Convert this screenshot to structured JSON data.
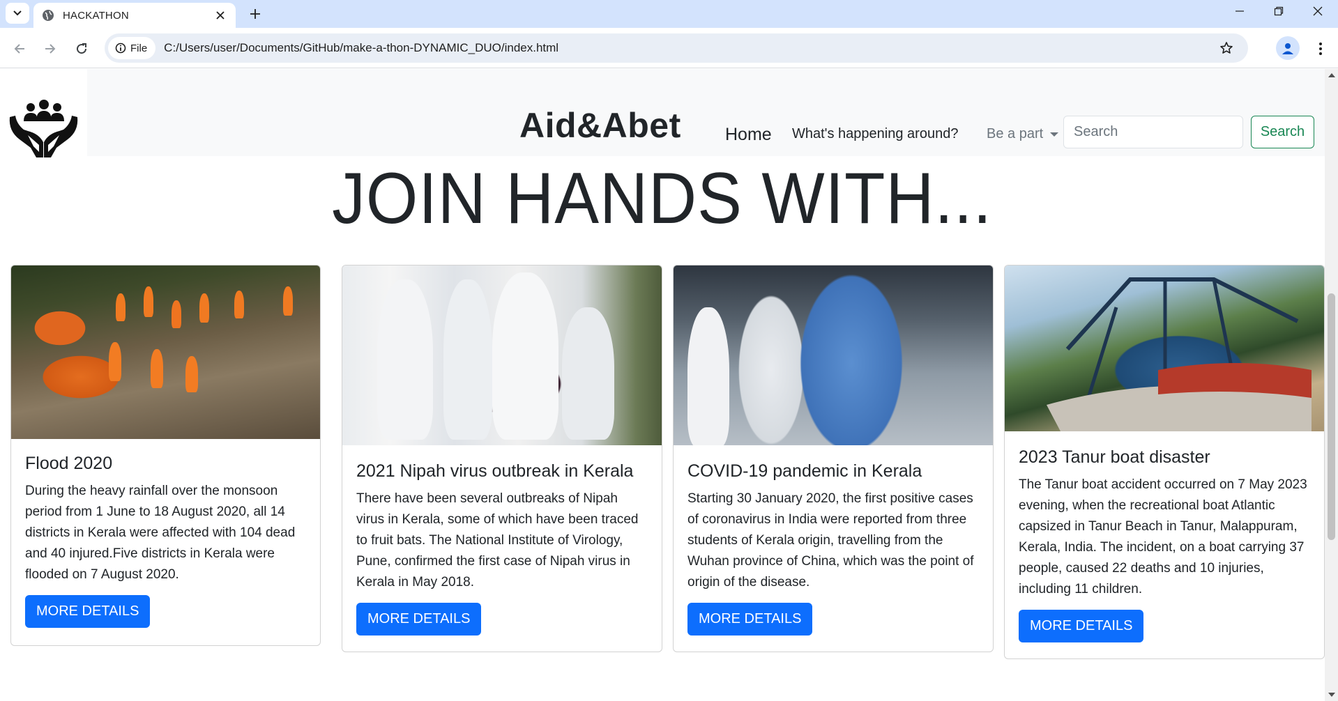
{
  "browser": {
    "tab_title": "HACKATHON",
    "file_chip": "File",
    "url": "C:/Users/user/Documents/GitHub/make-a-thon-DYNAMIC_DUO/index.html"
  },
  "navbar": {
    "brand": "Aid&Abet",
    "links": {
      "home": "Home",
      "happening": "What's happening around?",
      "bepart": "Be a part"
    },
    "search_placeholder": "Search",
    "search_button": "Search"
  },
  "hero": {
    "heading": "JOIN HANDS WITH..."
  },
  "cards": [
    {
      "title": "Flood 2020",
      "text": "During the heavy rainfall over the monsoon period from 1 June to 18 August 2020, all 14 districts in Kerala were affected with 104 dead and 40 injured.Five districts in Kerala were flooded on 7 August 2020.",
      "button": "MORE DETAILS"
    },
    {
      "title": "2021 Nipah virus outbreak in Kerala",
      "text": "There have been several outbreaks of Nipah virus in Kerala, some of which have been traced to fruit bats. The National Institute of Virology, Pune, confirmed the first case of Nipah virus in Kerala in May 2018.",
      "button": "MORE DETAILS"
    },
    {
      "title": "COVID-19 pandemic in Kerala",
      "text": "Starting 30 January 2020, the first positive cases of coronavirus in India were reported from three students of Kerala origin, travelling from the Wuhan province of China, which was the point of origin of the disease.",
      "button": "MORE DETAILS"
    },
    {
      "title": "2023 Tanur boat disaster",
      "text": "The Tanur boat accident occurred on 7 May 2023 evening, when the recreational boat Atlantic capsized in Tanur Beach in Tanur, Malappuram, Kerala, India. The incident, on a boat carrying 37 people, caused 22 deaths and 10 injuries, including 11 children.",
      "button": "MORE DETAILS"
    }
  ],
  "colors": {
    "primary": "#0d6efd",
    "success": "#198754",
    "navbar_bg": "#f8f9fa",
    "chrome_tabstrip": "#d3e3fd"
  },
  "icons": [
    "tab-list-icon",
    "globe-icon",
    "close-icon",
    "plus-icon",
    "minimize-icon",
    "restore-icon",
    "window-close-icon",
    "back-icon",
    "forward-icon",
    "reload-icon",
    "info-icon",
    "star-icon",
    "profile-icon",
    "menu-icon",
    "logo-icon"
  ]
}
